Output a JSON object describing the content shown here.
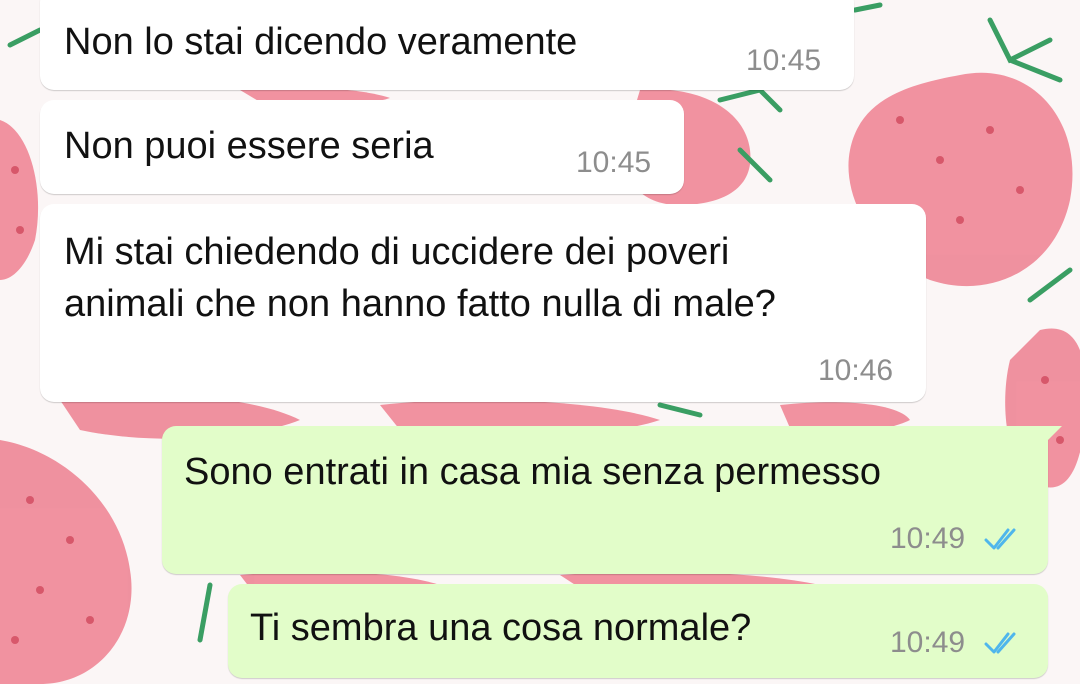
{
  "chat": {
    "messages": [
      {
        "direction": "incoming",
        "text": "Non lo stai dicendo veramente",
        "time": "10:45"
      },
      {
        "direction": "incoming",
        "text": "Non puoi essere seria",
        "time": "10:45"
      },
      {
        "direction": "incoming",
        "text": "Mi stai chiedendo di uccidere dei poveri\nanimali che non hanno fatto nulla di male?",
        "time": "10:46"
      },
      {
        "direction": "outgoing",
        "text": "Sono entrati in casa mia senza permesso",
        "time": "10:49",
        "status": "read"
      },
      {
        "direction": "outgoing",
        "text": "Ti sembra una cosa normale?",
        "time": "10:49",
        "status": "read"
      }
    ]
  },
  "colors": {
    "incoming_bubble": "#ffffff",
    "outgoing_bubble": "#e2fdc9",
    "read_ticks": "#4fb6ec",
    "wallpaper_strawberry": "#e86a7a"
  },
  "wallpaper": {
    "pattern": "strawberry-pattern"
  }
}
